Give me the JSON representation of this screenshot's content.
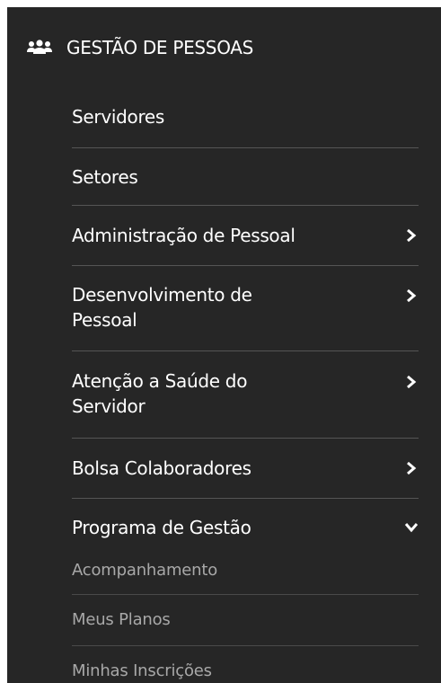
{
  "section": {
    "title": "GESTÃO DE PESSOAS",
    "icon": "users-icon"
  },
  "menu": {
    "servidores": "Servidores",
    "setores": "Setores",
    "administracao": "Administração de Pessoal",
    "desenvolvimento_l1": "Desenvolvimento de",
    "desenvolvimento_l2": "Pessoal",
    "atencao_l1": "Atenção a Saúde do",
    "atencao_l2": "Servidor",
    "bolsa": "Bolsa Colaboradores",
    "programa": "Programa de Gestão"
  },
  "submenu": {
    "acompanhamento": "Acompanhamento",
    "meus_planos": "Meus Planos",
    "minhas_inscricoes": "Minhas Inscrições"
  },
  "colors": {
    "panel_bg": "#262626",
    "text": "#ffffff",
    "submenu_text": "#a8a8a8",
    "divider": "#555555"
  }
}
